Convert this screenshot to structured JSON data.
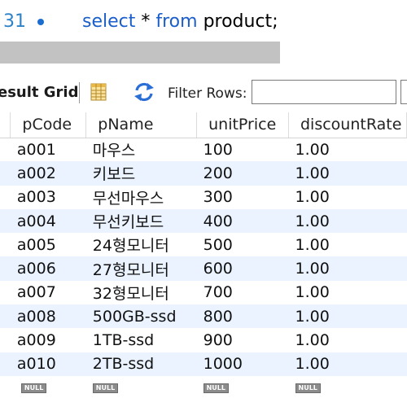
{
  "editor": {
    "line_number": "31",
    "sql_keyword_select": "select",
    "sql_star": " * ",
    "sql_keyword_from": "from",
    "sql_rest": " product;"
  },
  "toolbar": {
    "result_grid_label": "esult Grid",
    "grid_icon": "grid-icon",
    "refresh_icon": "refresh-icon",
    "filter_label": "Filter Rows:",
    "filter_value": ""
  },
  "colors": {
    "keyword": "#1a5fc9",
    "line_number": "#2e82c8",
    "alt_row": "#eaf3ff",
    "null_badge": "#8c8c8c"
  },
  "grid": {
    "columns": [
      "pCode",
      "pName",
      "unitPrice",
      "discountRate"
    ],
    "rows": [
      [
        "a001",
        "마우스",
        "100",
        "1.00"
      ],
      [
        "a002",
        "키보드",
        "200",
        "1.00"
      ],
      [
        "a003",
        "무선마우스",
        "300",
        "1.00"
      ],
      [
        "a004",
        "무선키보드",
        "400",
        "1.00"
      ],
      [
        "a005",
        "24형모니터",
        "500",
        "1.00"
      ],
      [
        "a006",
        "27형모니터",
        "600",
        "1.00"
      ],
      [
        "a007",
        "32형모니터",
        "700",
        "1.00"
      ],
      [
        "a008",
        "500GB-ssd",
        "800",
        "1.00"
      ],
      [
        "a009",
        "1TB-ssd",
        "900",
        "1.00"
      ],
      [
        "a010",
        "2TB-ssd",
        "1000",
        "1.00"
      ]
    ],
    "null_label": "NULL"
  }
}
